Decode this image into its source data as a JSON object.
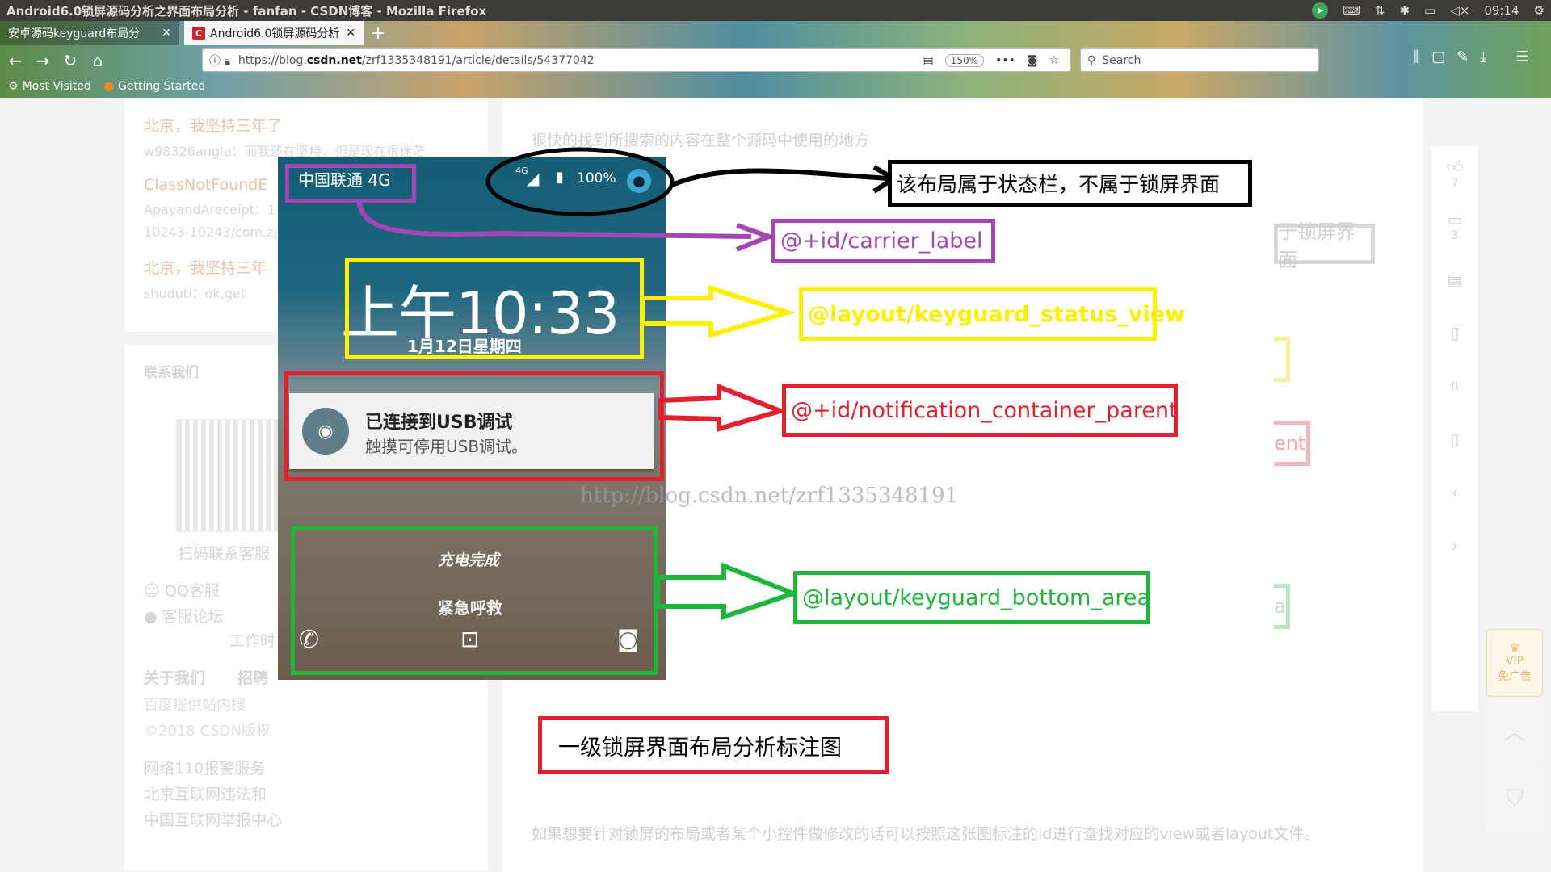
{
  "os": {
    "window_title": "Android6.0锁屏源码分析之界面布局分析 - fanfan - CSDN博客 - Mozilla Firefox",
    "clock": "09:14"
  },
  "browser": {
    "tabs": [
      {
        "label": "安卓源码keyguard布局分"
      },
      {
        "label": "Android6.0锁屏源码分析"
      }
    ],
    "new_tab": "+",
    "url_prefix": "https://blog.",
    "url_domain": "csdn.net",
    "url_path": "/zrf1335348191/article/details/54377042",
    "zoom": "150%",
    "search_placeholder": "Search",
    "bookmarks": [
      "Most Visited",
      "Getting Started"
    ]
  },
  "sidebar": {
    "comments": [
      {
        "title": "北京，我坚持三年了",
        "text": "w98326angle：而我还在坚持，但是现在很迷茫"
      },
      {
        "title": "ClassNotFoundE",
        "text": "ApayandAreceipt：1"
      },
      {
        "title": "",
        "text": "10243-10243/com.zj"
      },
      {
        "title": "北京，我坚持三年",
        "text": "shuduti：ok,get"
      }
    ],
    "contact_heading": "联系我们",
    "qr_caption": "扫码联系客服",
    "qq": "QQ客服",
    "forum": "客服论坛",
    "hours": "工作时",
    "about": "关于我们",
    "jobs": "招聘",
    "baidu": "百度提供站内搜",
    "copyright": "©2018 CSDN版权",
    "police": "网络110报警服务",
    "beijing": "北京互联网违法和",
    "report": "中国互联网举报中心"
  },
  "article": {
    "para_top": "很快的找到所搜索的内容在整个源码中使用的地方",
    "para_bottom": "如果想要针对锁屏的布局或者某个小控件做修改的话可以按照这张图标注的id进行查找对应的view或者layout文件。",
    "watermark": "http://blog.csdn.net/zrf1335348191"
  },
  "phone": {
    "carrier": "中国联通 4G",
    "net": "4G",
    "battery": "100%",
    "time": "上午10:33",
    "date": "1月12日星期四",
    "notif_title": "已连接到USB调试",
    "notif_text": "触摸可停用USB调试。",
    "charging": "充电完成",
    "emergency": "紧急呼救"
  },
  "annotations": {
    "status_bar": "该布局属于状态栏，不属于锁屏界面",
    "carrier": "@+id/carrier_label",
    "status_view": "@layout/keyguard_status_view",
    "notification": "@+id/notification_container_parent",
    "bottom": "@layout/keyguard_bottom_area",
    "caption": "一级锁屏界面布局分析标注图"
  },
  "right_rail": {
    "likes": "7",
    "comments": "3"
  },
  "ghosts": {
    "status_bar": "于锁屏界面",
    "notification": "ent",
    "bottom": "a"
  },
  "vip": {
    "line1": "VIP",
    "line2": "免广告"
  },
  "colors": {
    "purple": "#a546b5",
    "yellow": "#ffef00",
    "red": "#e5202e",
    "green": "#1eb53a",
    "black": "#000000"
  }
}
